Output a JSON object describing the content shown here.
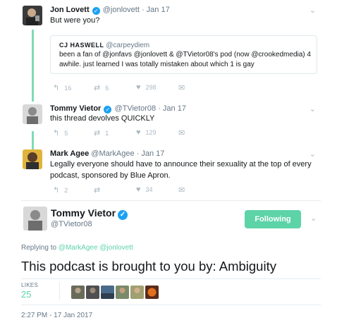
{
  "tweets": [
    {
      "name": "Jon Lovett",
      "handle": "@jonlovett",
      "date": "· Jan 17",
      "text": "But were you?",
      "quote": {
        "name": "CJ HASWELL",
        "handle": "@carpeydiem",
        "text": "been a fan of @jonfavs @jonlovett & @TVietor08's pod (now @crookedmedia) 4 awhile. just learned I was totally mistaken about which 1 is gay"
      },
      "replies": "16",
      "retweets": "6",
      "likes": "298"
    },
    {
      "name": "Tommy Vietor",
      "handle": "@TVietor08",
      "date": "· Jan 17",
      "text": "this thread devolves QUICKLY",
      "replies": "5",
      "retweets": "1",
      "likes": "129"
    },
    {
      "name": "Mark Agee",
      "handle": "@MarkAgee",
      "date": "· Jan 17",
      "text": "Legally everyone should have to announce their sexuality at the top of every podcast, sponsored by Blue Apron.",
      "replies": "2",
      "retweets": "",
      "likes": "34"
    }
  ],
  "main_tweet": {
    "name": "Tommy Vietor",
    "handle": "@TVietor08",
    "follow_label": "Following",
    "replying_prefix": "Replying to",
    "replying_to": "@MarkAgee @jonlovett",
    "text": "This podcast is brought to you by: Ambiguity",
    "likes_label": "LIKES",
    "likes_count": "25",
    "timestamp": "2:27 PM - 17 Jan 2017"
  },
  "icons": {
    "verified": "verified-check-icon",
    "reply": "reply-icon",
    "retweet": "retweet-icon",
    "like": "heart-icon",
    "dm": "direct-message-icon",
    "caret": "chevron-down-icon"
  },
  "colors": {
    "accent": "#5dd3a8",
    "thread_line": "#7fdbb6",
    "verified": "#1da1f2",
    "muted": "#657786"
  }
}
